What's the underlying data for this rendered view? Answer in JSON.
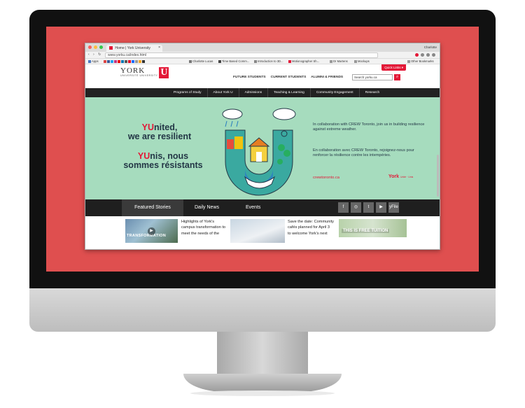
{
  "browser": {
    "tab_title": "Home | York University",
    "tab_close": "×",
    "user": "Charlotte",
    "nav_buttons": "‹ › ↻",
    "url": "www.yorku.ca/index.html",
    "bookmarks": [
      {
        "label": "Apps"
      },
      {
        "label": "Charlotte Lucas"
      },
      {
        "label": "Time Based Comm..."
      },
      {
        "label": "Introduction to 3D..."
      },
      {
        "label": "Motionographer Sh..."
      },
      {
        "label": "Dr Martens"
      },
      {
        "label": "Mockups"
      },
      {
        "label": "Other Bookmarks"
      }
    ]
  },
  "site": {
    "logo_text": "YORK",
    "logo_sub": "UNIVERSITÉ UNIVERSITY",
    "logo_mark": "U",
    "quick_links": "Quick Links ▾",
    "main_nav": [
      "FUTURE STUDENTS",
      "CURRENT STUDENTS",
      "ALUMNI & FRIENDS"
    ],
    "search_placeholder": "Search yorku.ca",
    "search_icon": "⌕",
    "sub_nav": [
      "Programs of Study",
      "About York U",
      "Admissions",
      "Teaching & Learning",
      "Community Engagement",
      "Research"
    ]
  },
  "hero": {
    "en_red": "YU",
    "en_rest_1": "nited,",
    "en_line2": "we are resilient",
    "fr_red": "YU",
    "fr_rest_1": "nis, nous",
    "fr_line2": "sommes résistants",
    "p_en": "In collaboration with CREW Toronto, join us in building resilience against extreme weather.",
    "p_fr": "En collaboration avec CREW Toronto, rejoignez-nous pour renforcer la résilience contre les intempéries.",
    "link": "crewtoronto.ca",
    "york_mark": "York",
    "york_mark_sub": "Unité · Unis"
  },
  "tabs": {
    "featured": "Featured Stories",
    "daily": "Daily News",
    "events": "Events"
  },
  "social": [
    "f",
    "◎",
    "t",
    "▶",
    "yFile"
  ],
  "stories": [
    {
      "thumb_label": "TRANSFORMATION",
      "text": "Highlights of York's campus transformation to meet the needs of the"
    },
    {
      "text": "Save the date: Community cafés planned for April 3 to welcome York's next"
    },
    {
      "thumb_label": "THIS IS FREE TUITION"
    }
  ],
  "colors": {
    "monitor_screen": "#df4f4f",
    "york_red": "#e31837",
    "hero_bg": "#a6dcbe",
    "nav_dark": "#222222"
  }
}
